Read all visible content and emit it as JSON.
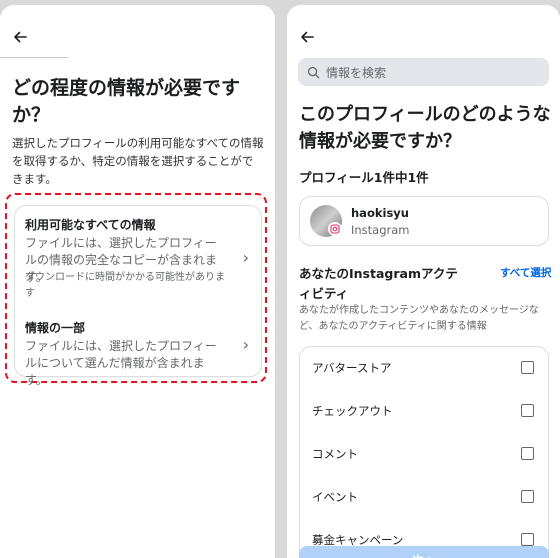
{
  "left": {
    "title": "どの程度の情報が必要ですか？",
    "description": "選択したプロフィールの利用可能なすべての情報を取得するか、特定の情報を選択することができます。",
    "options": [
      {
        "title": "利用可能なすべての情報",
        "desc": "ファイルには、選択したプロフィールの情報の完全なコピーが含まれます。",
        "note": "ダウンロードに時間がかかる可能性があります"
      },
      {
        "title": "情報の一部",
        "desc": "ファイルには、選択したプロフィールについて選んだ情報が含まれます。"
      }
    ]
  },
  "right": {
    "search_placeholder": "情報を検索",
    "title": "このプロフィールのどのような情報が必要ですか？",
    "profile_count": "プロフィール1件中1件",
    "profile": {
      "name": "haokisyu",
      "platform": "Instagram"
    },
    "section_title": "あなたのInstagramアクティビティ",
    "select_all": "すべて選択",
    "section_desc": "あなたが作成したコンテンツやあなたのメッセージなど、あなたのアクティビティに関する情報",
    "items": [
      "アバターストア",
      "チェックアウト",
      "コメント",
      "イベント",
      "募金キャンペーン"
    ],
    "next_button": "次へ"
  },
  "colors": {
    "highlight": "#e8121e",
    "link": "#0064e0",
    "disabled_button": "#b2d1f8"
  }
}
